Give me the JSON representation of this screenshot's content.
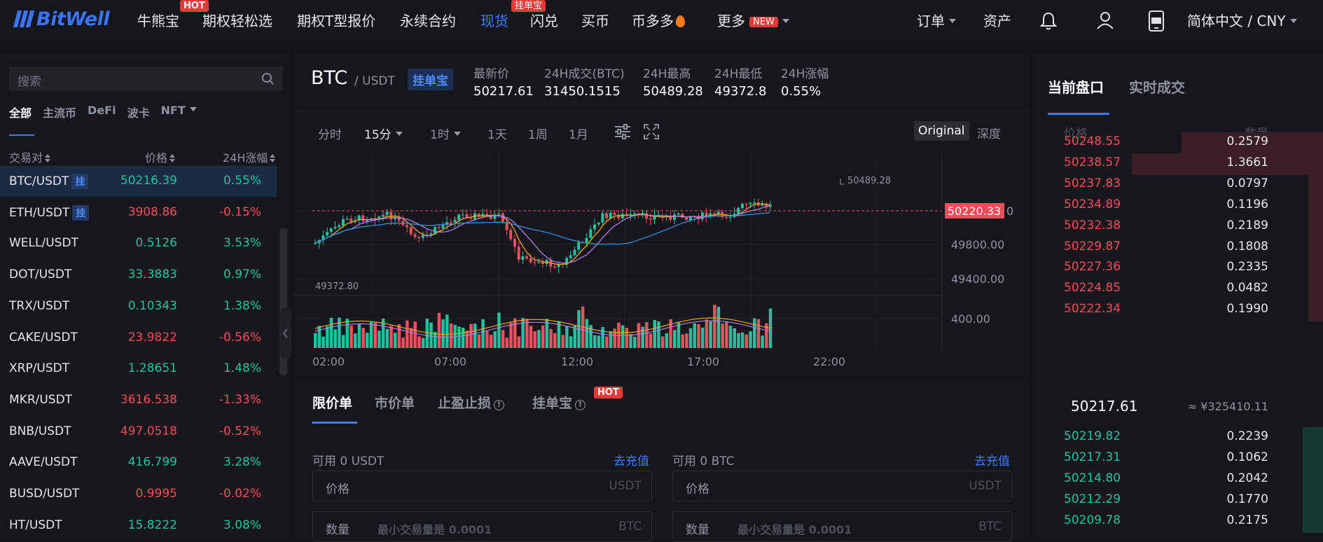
{
  "nav": {
    "logo_text": "BitWell",
    "items": [
      {
        "label": "牛熊宝"
      },
      {
        "label": "期权轻松选"
      },
      {
        "label": "期权T型报价"
      },
      {
        "label": "永续合约"
      },
      {
        "label": "现货"
      },
      {
        "label": "闪兑"
      },
      {
        "label": "买币"
      },
      {
        "label": "币多多"
      },
      {
        "label": "更多"
      }
    ],
    "badges": {
      "hot": "HOT",
      "guadanbao": "挂单宝",
      "new": "NEW"
    },
    "right": {
      "orders": "订单",
      "assets": "资产",
      "lang": "简体中文 / CNY"
    },
    "icons": [
      "bell-icon",
      "user-icon",
      "app-icon"
    ]
  },
  "markets": {
    "search_placeholder": "搜索",
    "tabs": [
      "全部",
      "主流币",
      "DeFi",
      "波卡",
      "NFT"
    ],
    "headers": {
      "pair": "交易对",
      "price": "价格",
      "change": "24H涨幅"
    },
    "gua": "挂",
    "rows": [
      {
        "pair": "BTC/USDT",
        "price": "50216.39",
        "change": "0.55%",
        "dir": "up",
        "gua": true
      },
      {
        "pair": "ETH/USDT",
        "price": "3908.86",
        "change": "-0.15%",
        "dir": "dn",
        "gua": true
      },
      {
        "pair": "WELL/USDT",
        "price": "0.5126",
        "change": "3.53%",
        "dir": "up"
      },
      {
        "pair": "DOT/USDT",
        "price": "33.3883",
        "change": "0.97%",
        "dir": "up"
      },
      {
        "pair": "TRX/USDT",
        "price": "0.10343",
        "change": "1.38%",
        "dir": "up"
      },
      {
        "pair": "CAKE/USDT",
        "price": "23.9822",
        "change": "-0.56%",
        "dir": "dn"
      },
      {
        "pair": "XRP/USDT",
        "price": "1.28651",
        "change": "1.48%",
        "dir": "up"
      },
      {
        "pair": "MKR/USDT",
        "price": "3616.538",
        "change": "-1.33%",
        "dir": "dn"
      },
      {
        "pair": "BNB/USDT",
        "price": "497.0518",
        "change": "-0.52%",
        "dir": "dn"
      },
      {
        "pair": "AAVE/USDT",
        "price": "416.799",
        "change": "3.28%",
        "dir": "up"
      },
      {
        "pair": "BUSD/USDT",
        "price": "0.9995",
        "change": "-0.02%",
        "dir": "dn"
      },
      {
        "pair": "HT/USDT",
        "price": "15.8222",
        "change": "3.08%",
        "dir": "up"
      }
    ]
  },
  "ticker": {
    "symbol": "BTC",
    "quote": "/ USDT",
    "badge": "挂单宝",
    "stats": [
      {
        "label": "最新价",
        "value": "50217.61"
      },
      {
        "label": "24H成交(BTC)",
        "value": "31450.1515"
      },
      {
        "label": "24H最高",
        "value": "50489.28"
      },
      {
        "label": "24H最低",
        "value": "49372.8"
      },
      {
        "label": "24H涨幅",
        "value": "0.55%"
      }
    ]
  },
  "chart_toolbar": {
    "intervals": [
      "分时",
      "15分",
      "1时",
      "1天",
      "1周",
      "1月"
    ],
    "original": "Original",
    "depth": "深度",
    "icons": [
      "indicator-settings-icon",
      "fullscreen-icon"
    ]
  },
  "chart_data": {
    "type": "candlestick",
    "price_ticks": [
      "49800.00",
      "49400.00"
    ],
    "volume_tick": "400.00",
    "x_ticks": [
      "02:00",
      "07:00",
      "12:00",
      "17:00",
      "22:00"
    ],
    "high_label": "50489.28",
    "low_label": "49372.80",
    "current_price_label": "50220.33",
    "colors": {
      "up": "#1ec39e",
      "down": "#f04e5b",
      "ma_a": "#f5a623",
      "ma_b": "#b27ee6",
      "ma_c": "#2e8fe0"
    }
  },
  "order_form": {
    "tabs": [
      "限价单",
      "市价单",
      "止盈止损",
      "挂单宝"
    ],
    "hot": "HOT",
    "buy": {
      "available": "可用 0 USDT",
      "deposit": "去充值",
      "price_label": "价格",
      "price_unit": "USDT",
      "qty_label": "数量",
      "qty_hint": "最小交易量是 0.0001",
      "qty_unit": "BTC"
    },
    "sell": {
      "available": "可用 0 BTC",
      "deposit": "去充值",
      "price_label": "价格",
      "price_unit": "USDT",
      "qty_label": "数量",
      "qty_hint": "最小交易量是 0.0001",
      "qty_unit": "BTC"
    }
  },
  "orderbook": {
    "tabs": [
      "当前盘口",
      "实时成交"
    ],
    "headers": {
      "price": "价格",
      "qty": "数量"
    },
    "asks": [
      {
        "price": "50248.55",
        "qty": "0.2579",
        "depth": 0.49
      },
      {
        "price": "50238.57",
        "qty": "1.3661",
        "depth": 0.66
      },
      {
        "price": "50237.83",
        "qty": "0.0797",
        "depth": 0.05
      },
      {
        "price": "50234.89",
        "qty": "0.1196",
        "depth": 0.05
      },
      {
        "price": "50232.38",
        "qty": "0.2189",
        "depth": 0.05
      },
      {
        "price": "50229.87",
        "qty": "0.1808",
        "depth": 0.05
      },
      {
        "price": "50227.36",
        "qty": "0.2335",
        "depth": 0.05
      },
      {
        "price": "50224.85",
        "qty": "0.0482",
        "depth": 0.05
      },
      {
        "price": "50222.34",
        "qty": "0.1990",
        "depth": 0.05
      }
    ],
    "last_price": "50217.61",
    "last_cny": "≈ ¥325410.11",
    "bids": [
      {
        "price": "50219.82",
        "qty": "0.2239",
        "depth": 0.07
      },
      {
        "price": "50217.31",
        "qty": "0.1062",
        "depth": 0.07
      },
      {
        "price": "50214.80",
        "qty": "0.2042",
        "depth": 0.07
      },
      {
        "price": "50212.29",
        "qty": "0.1770",
        "depth": 0.07
      },
      {
        "price": "50209.78",
        "qty": "0.2175",
        "depth": 0.07
      }
    ]
  }
}
